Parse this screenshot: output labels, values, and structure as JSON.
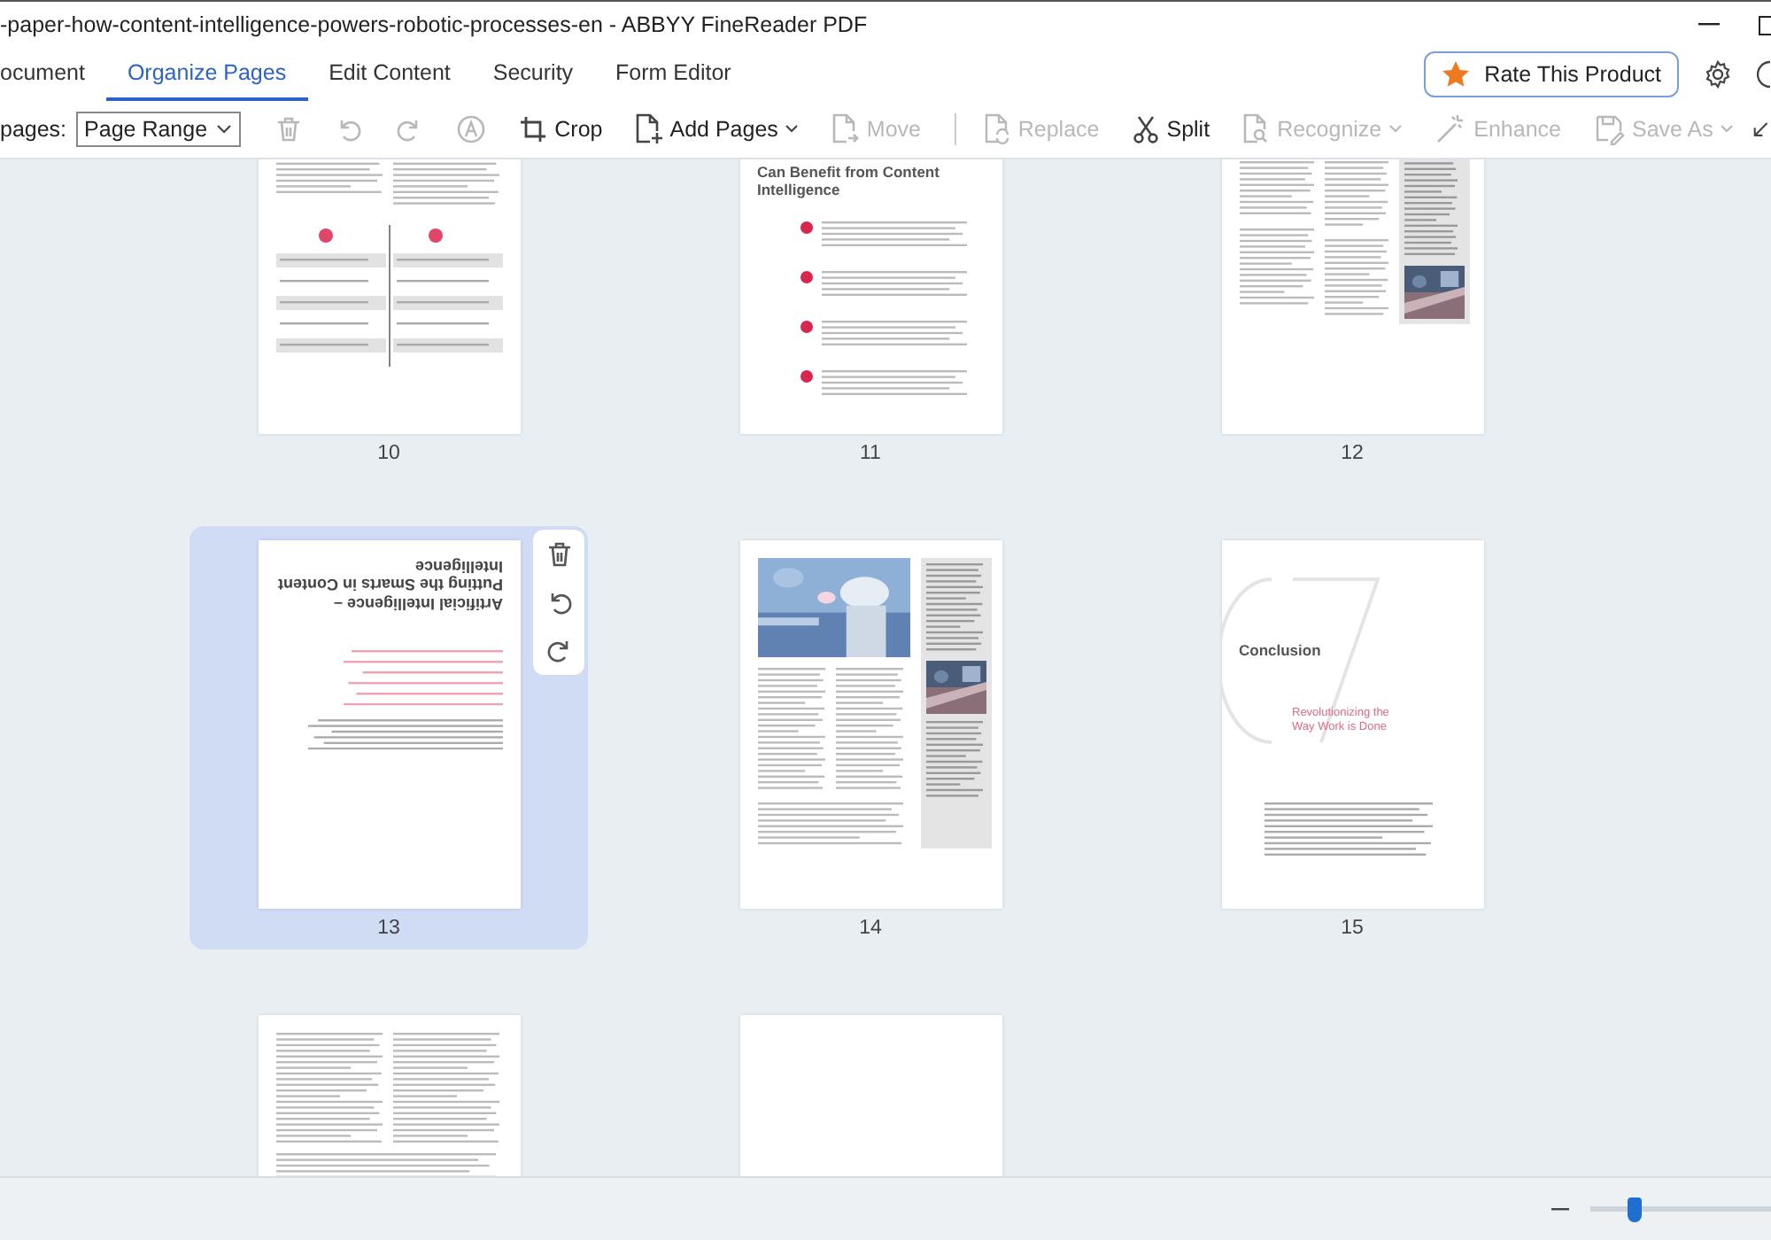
{
  "window": {
    "title": "-paper-how-content-intelligence-powers-robotic-processes-en - ABBYY FineReader PDF"
  },
  "tabs": [
    {
      "label": "ocument",
      "selected": false
    },
    {
      "label": "Organize Pages",
      "selected": true
    },
    {
      "label": "Edit Content",
      "selected": false
    },
    {
      "label": "Security",
      "selected": false
    },
    {
      "label": "Form Editor",
      "selected": false
    }
  ],
  "rate_button": {
    "label": "Rate This Product"
  },
  "toolbar": {
    "pages_label": "pages:",
    "page_range": {
      "value": "Page Range"
    },
    "tools": [
      {
        "kind": "trash",
        "disabled": true
      },
      {
        "kind": "undo",
        "disabled": true
      },
      {
        "kind": "redo",
        "disabled": true
      },
      {
        "kind": "stamp",
        "disabled": true
      },
      {
        "kind": "crop",
        "label": "Crop",
        "disabled": false
      },
      {
        "kind": "add",
        "label": "Add Pages",
        "dropdown": true,
        "disabled": false
      },
      {
        "kind": "move",
        "label": "Move",
        "disabled": true
      },
      {
        "kind": "separator"
      },
      {
        "kind": "replace",
        "label": "Replace",
        "disabled": true
      },
      {
        "kind": "split",
        "label": "Split",
        "disabled": false
      },
      {
        "kind": "recognize",
        "label": "Recognize",
        "dropdown": true,
        "disabled": true
      },
      {
        "kind": "enhance",
        "label": "Enhance",
        "disabled": true
      },
      {
        "kind": "save",
        "label": "Save As",
        "dropdown": true,
        "disabled": true
      }
    ]
  },
  "pages": [
    {
      "number": "10",
      "kind": "table",
      "selected": false
    },
    {
      "number": "11",
      "kind": "list",
      "selected": false,
      "heading": "Can Benefit from Content Intelligence"
    },
    {
      "number": "12",
      "kind": "sidebar",
      "selected": false
    },
    {
      "number": "13",
      "kind": "rotated",
      "selected": true,
      "heading": "Artificial Intelligence – Putting the Smarts in Content Intelligence"
    },
    {
      "number": "14",
      "selected": false
    },
    {
      "number": "15",
      "kind": "conclusion",
      "selected": false,
      "heading": "Conclusion",
      "subheading": "Revolutionizing the Way Work is Done"
    },
    {
      "kind": "columns",
      "selected": false
    },
    {
      "kind": "blank",
      "selected": false
    }
  ],
  "status_bar": {
    "zoom": {
      "level": 0.25
    }
  }
}
